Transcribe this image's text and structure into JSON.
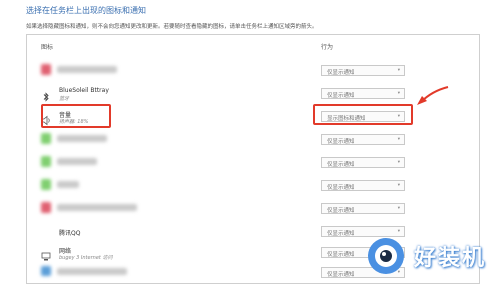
{
  "title": "选择在任务栏上出现的图标和通知",
  "subtitle": "如果选择隐藏图标和通知，则不会向您通知更改和更新。若要随时查看隐藏的图标，请单击任务栏上通知区域旁的箭头。",
  "columns": {
    "icons": "图标",
    "behavior": "行为"
  },
  "rows": [
    {
      "name": "",
      "desc": "",
      "behavior": "仅显示通知",
      "blurred": true,
      "color": "#e06070"
    },
    {
      "name": "BlueSoleil Bttray",
      "desc": "蓝牙",
      "behavior": "仅显示通知",
      "blurred": false,
      "icon": "bluetooth-icon"
    },
    {
      "name": "音量",
      "desc": "扬声器: 18%",
      "behavior": "显示图标和通知",
      "blurred": false,
      "icon": "speaker-icon"
    },
    {
      "name": "",
      "desc": "",
      "behavior": "仅显示通知",
      "blurred": true,
      "color": "#7fcf6f"
    },
    {
      "name": "",
      "desc": "",
      "behavior": "仅显示通知",
      "blurred": true,
      "color": "#7fcf6f"
    },
    {
      "name": "",
      "desc": "",
      "behavior": "仅显示通知",
      "blurred": true,
      "color": "#7fcf6f"
    },
    {
      "name": "",
      "desc": "",
      "behavior": "仅显示通知",
      "blurred": true,
      "color": "#e06070"
    },
    {
      "name": "腾讯QQ",
      "desc": "",
      "behavior": "仅显示通知",
      "blurred": false,
      "icon": "qq-icon"
    },
    {
      "name": "网络",
      "desc": "bugey 3 Internet 访问",
      "behavior": "仅显示通知",
      "blurred": false,
      "icon": "network-icon"
    },
    {
      "name": "",
      "desc": "",
      "behavior": "仅显示通知",
      "blurred": true,
      "color": "#5b9ed8"
    }
  ],
  "watermark": {
    "text": "好装机"
  },
  "colors": {
    "highlight": "#e23a2a",
    "title": "#3a6fb0"
  }
}
